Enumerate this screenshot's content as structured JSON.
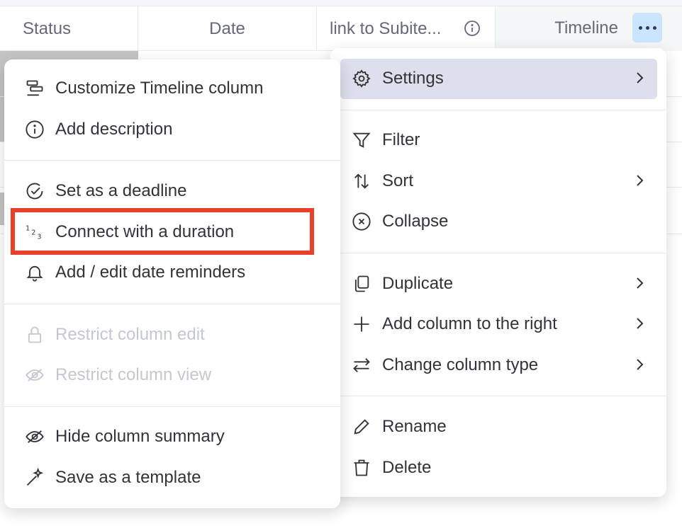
{
  "header": {
    "status": "Status",
    "date": "Date",
    "link": "link to Subite...",
    "timeline": "Timeline"
  },
  "left_menu": {
    "customize": "Customize Timeline column",
    "add_description": "Add description",
    "set_deadline": "Set as a deadline",
    "connect_duration": "Connect with a duration",
    "date_reminders": "Add / edit date reminders",
    "restrict_edit": "Restrict column edit",
    "restrict_view": "Restrict column view",
    "hide_summary": "Hide column summary",
    "save_template": "Save as a template"
  },
  "right_menu": {
    "settings": "Settings",
    "filter": "Filter",
    "sort": "Sort",
    "collapse": "Collapse",
    "duplicate": "Duplicate",
    "add_column_right": "Add column to the right",
    "change_type": "Change column type",
    "rename": "Rename",
    "delete": "Delete"
  },
  "colors": {
    "highlight_border": "#e8402a",
    "active_item_bg": "#dcdfec",
    "more_button_bg": "#cce5ff"
  }
}
